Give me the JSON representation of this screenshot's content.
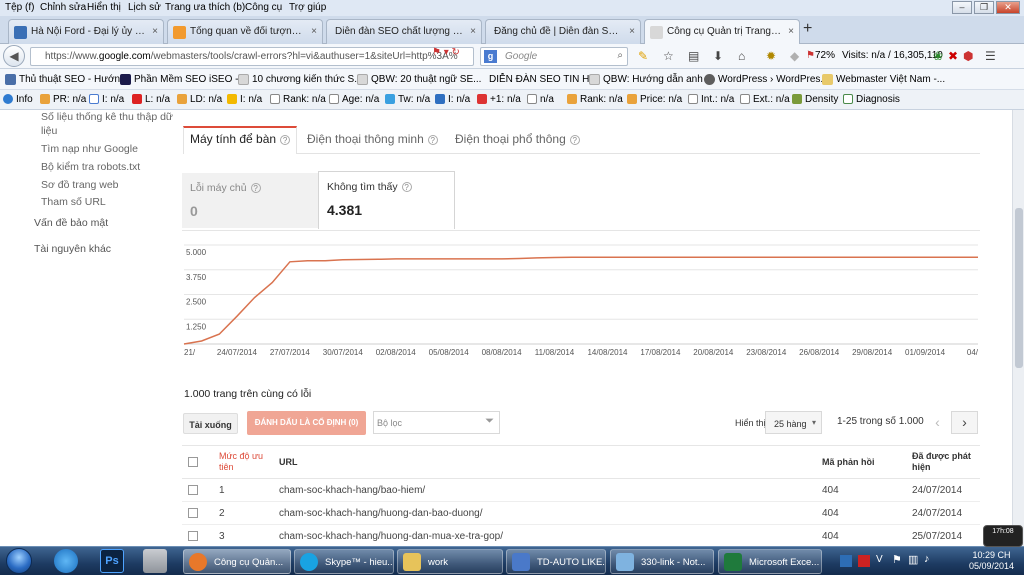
{
  "menu": [
    "Tệp (f)",
    "Chỉnh sửa",
    "Hiển thị",
    "Lịch sử",
    "Trang ưa thích (b)",
    "Công cụ",
    "Trợ giúp"
  ],
  "tabs": [
    {
      "label": "Hà Nội Ford - Đại lý ủy quy...",
      "color": "#3a6fb5",
      "active": false
    },
    {
      "label": "Tổng quan về đối tượng - ...",
      "color": "#f29a2e",
      "active": false
    },
    {
      "label": "Diễn đàn SEO chất lượng và uy ...",
      "color": "#d8d8d8",
      "active": false
    },
    {
      "label": "Đăng chủ đề | Diễn đàn SEO ch...",
      "color": "#d8d8d8",
      "active": false
    },
    {
      "label": "Công cụ Quản trị Trang W...",
      "color": "#d8d8d8",
      "active": true
    }
  ],
  "url": {
    "prefix": "https://www.",
    "domain": "google.com",
    "path": "/webmasters/tools/crawl-errors?hl=vi&authuser=1&siteUrl=http%3A%"
  },
  "search": {
    "placeholder": "Google",
    "engine_icon": "google-icon"
  },
  "nav": {
    "seo_pct": "72%",
    "visits": "Visits: n/a / 16,305,110"
  },
  "bookmarks": [
    {
      "label": "Thủ thuật SEO - Hướn...",
      "color": "#4a6fa8"
    },
    {
      "label": "Phần Mềm SEO iSEO - ...",
      "color": "#1a1a4a"
    },
    {
      "label": "10 chương kiến thức S...",
      "color": "#d8d8d8"
    },
    {
      "label": "QBW: 20 thuật ngữ SE...",
      "color": "#d8d8d8"
    },
    {
      "label": "DIỄN ĐÀN SEO TIN H...",
      "color": "#ffffff"
    },
    {
      "label": "QBW: Hướng dẫn anh ...",
      "color": "#d8d8d8"
    },
    {
      "label": "WordPress › WordPres...",
      "color": "#5e5e5e"
    },
    {
      "label": "Webmaster Việt Nam -...",
      "color": "#e8c96a"
    }
  ],
  "seoquake": [
    {
      "label": "Info"
    },
    {
      "label": "PR: n/a"
    },
    {
      "label": "I: n/a"
    },
    {
      "label": "L: n/a"
    },
    {
      "label": "LD: n/a"
    },
    {
      "label": "I: n/a"
    },
    {
      "label": "Rank: n/a"
    },
    {
      "label": "Age: n/a"
    },
    {
      "label": "Tw: n/a"
    },
    {
      "label": "I: n/a"
    },
    {
      "label": "+1: n/a"
    },
    {
      "label": "n/a"
    },
    {
      "label": "Rank: n/a"
    },
    {
      "label": "Price: n/a"
    },
    {
      "label": "Int.: n/a"
    },
    {
      "label": "Ext.: n/a"
    },
    {
      "label": "Density"
    },
    {
      "label": "Diagnosis"
    }
  ],
  "sidebar": {
    "items": [
      {
        "label": "Số liệu thống kê thu thập dữ"
      },
      {
        "label": "liệu"
      },
      {
        "label": "Tìm nạp như Google"
      },
      {
        "label": "Bộ kiểm tra robots.txt"
      },
      {
        "label": "Sơ đồ trang web"
      },
      {
        "label": "Tham số URL"
      },
      {
        "label": "Vấn đề bảo mật"
      },
      {
        "label": "Tài nguyên khác"
      }
    ]
  },
  "device_tabs": [
    "Máy tính để bàn",
    "Điện thoại thông minh",
    "Điện thoại phổ thông"
  ],
  "stats": {
    "server_label": "Lỗi máy chủ",
    "server_value": "0",
    "notfound_label": "Không tìm thấy",
    "notfound_value": "4.381"
  },
  "chart_data": {
    "type": "line",
    "x": [
      "21/07/2014",
      "22/07/2014",
      "23/07/2014",
      "24/07/2014",
      "25/07/2014",
      "26/07/2014",
      "27/07/2014",
      "28/07/2014",
      "29/07/2014",
      "30/07/2014",
      "31/07/2014",
      "01/08/2014",
      "02/08/2014",
      "03/08/2014",
      "04/08/2014",
      "05/08/2014",
      "06/08/2014",
      "07/08/2014",
      "08/08/2014",
      "09/08/2014",
      "10/08/2014",
      "11/08/2014",
      "12/08/2014",
      "13/08/2014",
      "14/08/2014",
      "15/08/2014",
      "16/08/2014",
      "17/08/2014",
      "18/08/2014",
      "19/08/2014",
      "20/08/2014",
      "21/08/2014",
      "22/08/2014",
      "23/08/2014",
      "24/08/2014",
      "25/08/2014",
      "26/08/2014",
      "27/08/2014",
      "28/08/2014",
      "29/08/2014",
      "30/08/2014",
      "31/08/2014",
      "01/09/2014",
      "02/09/2014",
      "03/09/2014",
      "04/09/2014"
    ],
    "series": [
      {
        "color": "#d9734f",
        "values": [
          0,
          150,
          500,
          1400,
          2350,
          3100,
          4150,
          4200,
          4200,
          4250,
          4270,
          4280,
          4300,
          4300,
          4300,
          4300,
          4300,
          4300,
          4300,
          4320,
          4350,
          4370,
          4380,
          4380,
          4380,
          4380,
          4380,
          4380,
          4380,
          4380,
          4380,
          4380,
          4380,
          4380,
          4380,
          4380,
          4380,
          4380,
          4380,
          4380,
          4380,
          4380,
          4381,
          4381,
          4381,
          4381
        ]
      }
    ],
    "ylim": [
      0,
      5000
    ],
    "y_ticks": [
      "1.250",
      "2.500",
      "3.750",
      "5.000"
    ],
    "x_ticks": [
      "21/",
      "24/07/2014",
      "27/07/2014",
      "30/07/2014",
      "02/08/2014",
      "05/08/2014",
      "08/08/2014",
      "11/08/2014",
      "14/08/2014",
      "17/08/2014",
      "20/08/2014",
      "23/08/2014",
      "26/08/2014",
      "29/08/2014",
      "01/09/2014",
      "04/"
    ],
    "grid": true
  },
  "summary": "1.000 trang trên cùng có lỗi",
  "toolbar": {
    "download": "Tải xuống",
    "mark_fixed": "ĐÁNH DẤU LÀ CỐ ĐỊNH (0)",
    "filter_placeholder": "Bộ lọc",
    "show_label": "Hiển thị",
    "rows_value": "25 hàng",
    "paging": "1-25 trong số 1.000"
  },
  "table": {
    "headers": {
      "priority": "Mức độ ưu tiên",
      "url": "URL",
      "code": "Mã phản hồi",
      "detected": "Đã được phát hiện"
    },
    "rows": [
      {
        "priority": "1",
        "url": "cham-soc-khach-hang/bao-hiem/",
        "code": "404",
        "detected": "24/07/2014"
      },
      {
        "priority": "2",
        "url": "cham-soc-khach-hang/huong-dan-bao-duong/",
        "code": "404",
        "detected": "24/07/2014"
      },
      {
        "priority": "3",
        "url": "cham-soc-khach-hang/huong-dan-mua-xe-tra-gop/",
        "code": "404",
        "detected": "25/07/2014"
      }
    ]
  },
  "taskbar": {
    "tasks": [
      {
        "label": "Công cụ Quản...",
        "color": "#e8782a"
      },
      {
        "label": "Skype™ - hieu...",
        "color": "#19a3e3"
      },
      {
        "label": "work",
        "color": "#e7c35a"
      },
      {
        "label": "TD-AUTO LIKE...",
        "color": "#4a79c9"
      },
      {
        "label": "330-link - Not...",
        "color": "#7fb3e0"
      },
      {
        "label": "Microsoft Exce...",
        "color": "#1f7a3c"
      }
    ],
    "clock_time": "10:29 CH",
    "clock_date": "05/09/2014",
    "weather": "17h:08"
  }
}
